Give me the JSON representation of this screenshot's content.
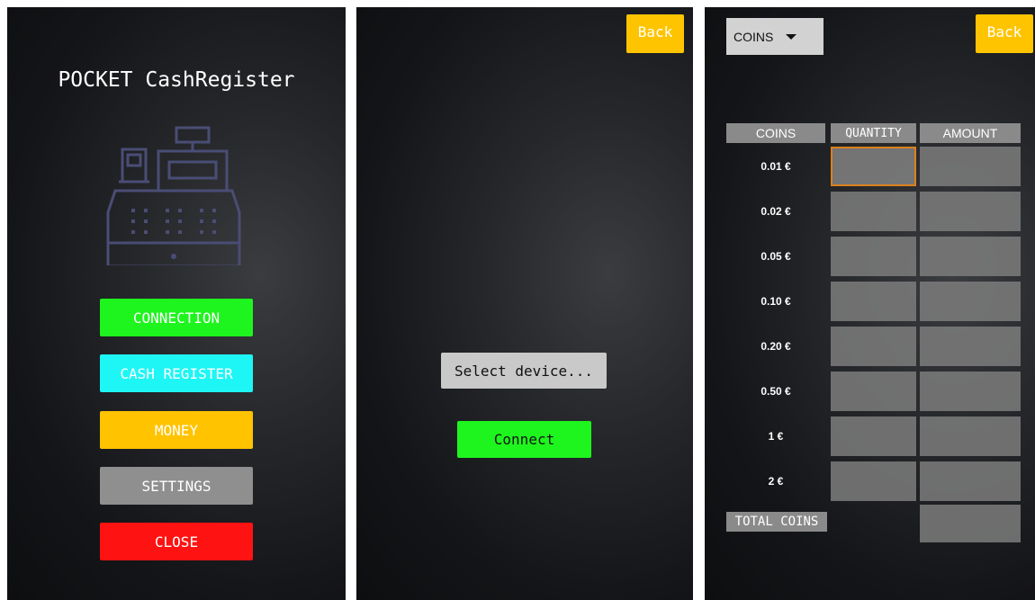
{
  "main_menu": {
    "title": "POCKET CashRegister",
    "icon": "cash-register-icon",
    "buttons": {
      "connection": "CONNECTION",
      "cash_register": "CASH REGISTER",
      "money": "MONEY",
      "settings": "SETTINGS",
      "close": "CLOSE"
    },
    "colors": {
      "connection": "#1ef51e",
      "cash_register": "#1ef6f6",
      "money": "#ffc300",
      "settings": "#8f8f8f",
      "close": "#ff1212"
    }
  },
  "connection_screen": {
    "back_label": "Back",
    "select_device": "Select device...",
    "connect_label": "Connect"
  },
  "money_screen": {
    "back_label": "Back",
    "dropdown_value": "COINS",
    "headers": {
      "coins": "COINS",
      "quantity": "QUANTITY",
      "amount": "AMOUNT"
    },
    "rows": [
      {
        "label": "0.01 €"
      },
      {
        "label": "0.02 €"
      },
      {
        "label": "0.05 €"
      },
      {
        "label": "0.10 €"
      },
      {
        "label": "0.20 €"
      },
      {
        "label": "0.50 €"
      },
      {
        "label": "1 €"
      },
      {
        "label": "2 €"
      }
    ],
    "total_label": "TOTAL COINS"
  }
}
